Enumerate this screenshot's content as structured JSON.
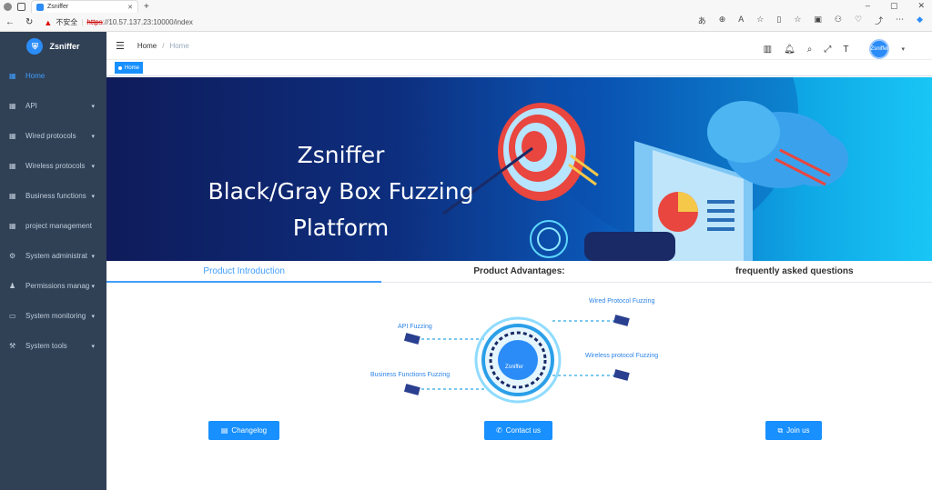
{
  "browser": {
    "tab_title": "Zsniffer",
    "new_tab": "+",
    "security_label": "不安全",
    "url_scheme": "https",
    "url_rest": "://10.57.137.23:10000/index"
  },
  "sidebar": {
    "brand": "Zsniffer",
    "items": [
      {
        "label": "Home",
        "icon": "dashboard-icon",
        "active": true,
        "has_children": false
      },
      {
        "label": "API",
        "icon": "grid-icon",
        "active": false,
        "has_children": true
      },
      {
        "label": "Wired protocols",
        "icon": "grid-icon",
        "active": false,
        "has_children": true
      },
      {
        "label": "Wireless protocols",
        "icon": "grid-icon",
        "active": false,
        "has_children": true
      },
      {
        "label": "Business functions",
        "icon": "grid-icon",
        "active": false,
        "has_children": true
      },
      {
        "label": "project management",
        "icon": "grid-icon",
        "active": false,
        "has_children": false
      },
      {
        "label": "System administrat",
        "icon": "gear-icon",
        "active": false,
        "has_children": true
      },
      {
        "label": "Permissions manag",
        "icon": "user-icon",
        "active": false,
        "has_children": true
      },
      {
        "label": "System monitoring",
        "icon": "monitor-icon",
        "active": false,
        "has_children": true
      },
      {
        "label": "System tools",
        "icon": "tools-icon",
        "active": false,
        "has_children": true
      }
    ]
  },
  "navbar": {
    "breadcrumb": [
      "Home",
      "Home"
    ],
    "separator": "/",
    "avatar_text": "Zsniffer"
  },
  "tagsview": {
    "tag_label": "Home"
  },
  "banner": {
    "title_line1": "Zsniffer",
    "title_line2": "Black/Gray Box Fuzzing Platform"
  },
  "tabs": [
    {
      "label": "Product Introduction",
      "active": true
    },
    {
      "label": "Product Advantages:",
      "active": false
    },
    {
      "label": "frequently asked questions",
      "active": false
    }
  ],
  "diagram": {
    "center_label": "Zsniffer",
    "nodes": [
      "API Fuzzing",
      "Business Functions Fuzzing",
      "Wired Protocol Fuzzing",
      "Wireless protocol Fuzzing"
    ]
  },
  "buttons": {
    "changelog": "Changelog",
    "contact": "Contact us",
    "join": "Join us"
  },
  "colors": {
    "sidebar_bg": "#304156",
    "accent": "#409eff",
    "button": "#1890ff"
  }
}
